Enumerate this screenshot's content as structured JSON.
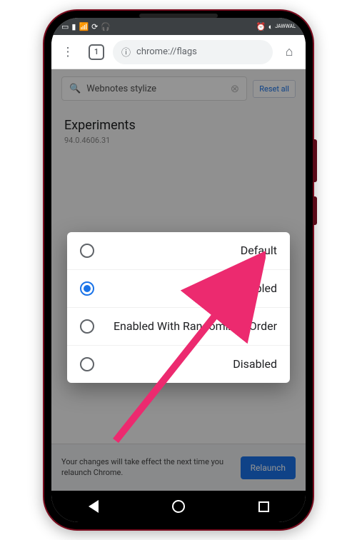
{
  "status": {
    "left_icons": "⬒ ▯",
    "right_text": "JAWWAL"
  },
  "address": {
    "url": "chrome://flags",
    "tabs_count": "1"
  },
  "search": {
    "value": "Webnotes stylize",
    "reset": "Reset all"
  },
  "page": {
    "title": "Experiments",
    "version": "94.0.4606.31"
  },
  "modal": {
    "options": [
      "Default",
      "Enabled",
      "Enabled With Randomized Order",
      "Disabled"
    ]
  },
  "relaunch": {
    "text": "Your changes will take effect the next time you relaunch Chrome.",
    "button": "Relaunch"
  }
}
